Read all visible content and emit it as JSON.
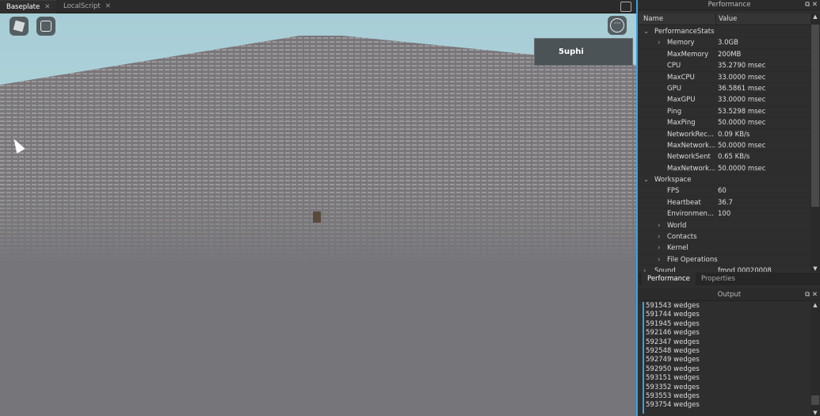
{
  "tabs": [
    {
      "label": "Baseplate",
      "active": true
    },
    {
      "label": "LocalScript",
      "active": false
    }
  ],
  "viewport": {
    "player_name": "5uphi"
  },
  "performance": {
    "title": "Performance",
    "columns": [
      "Name",
      "Value"
    ],
    "rows": [
      {
        "name": "PerformanceStats",
        "value": "",
        "level": 0,
        "expander": "expanded"
      },
      {
        "name": "Memory",
        "value": "3.0GB",
        "level": 2,
        "expander": "collapsed"
      },
      {
        "name": "MaxMemory",
        "value": "200MB",
        "level": 2
      },
      {
        "name": "CPU",
        "value": "35.2790 msec",
        "level": 2
      },
      {
        "name": "MaxCPU",
        "value": "33.0000 msec",
        "level": 2
      },
      {
        "name": "GPU",
        "value": "36.5861 msec",
        "level": 2
      },
      {
        "name": "MaxGPU",
        "value": "33.0000 msec",
        "level": 2
      },
      {
        "name": "Ping",
        "value": "53.5298 msec",
        "level": 2
      },
      {
        "name": "MaxPing",
        "value": "50.0000 msec",
        "level": 2
      },
      {
        "name": "NetworkRec...",
        "value": "0.09 KB/s",
        "level": 2
      },
      {
        "name": "MaxNetwork...",
        "value": "50.0000 msec",
        "level": 2
      },
      {
        "name": "NetworkSent",
        "value": "0.65 KB/s",
        "level": 2
      },
      {
        "name": "MaxNetwork...",
        "value": "50.0000 msec",
        "level": 2
      },
      {
        "name": "Workspace",
        "value": "",
        "level": 0,
        "expander": "expanded"
      },
      {
        "name": "FPS",
        "value": "60",
        "level": 2
      },
      {
        "name": "Heartbeat",
        "value": "36.7",
        "level": 2
      },
      {
        "name": "Environmen...",
        "value": "100",
        "level": 2
      },
      {
        "name": "World",
        "value": "",
        "level": 2,
        "expander": "collapsed"
      },
      {
        "name": "Contacts",
        "value": "",
        "level": 2,
        "expander": "collapsed"
      },
      {
        "name": "Kernel",
        "value": "",
        "level": 2,
        "expander": "collapsed"
      },
      {
        "name": "File Operations",
        "value": "",
        "level": 2,
        "expander": "collapsed"
      },
      {
        "name": "Sound",
        "value": "fmod 00020008",
        "level": 0,
        "expander": "collapsed"
      }
    ]
  },
  "panel_tabs": [
    "Performance",
    "Properties"
  ],
  "output": {
    "title": "Output",
    "lines": [
      "591543 wedges",
      "591744 wedges",
      "591945 wedges",
      "592146 wedges",
      "592347 wedges",
      "592548 wedges",
      "592749 wedges",
      "592950 wedges",
      "593151 wedges",
      "593352 wedges",
      "593553 wedges",
      "593754 wedges"
    ]
  }
}
